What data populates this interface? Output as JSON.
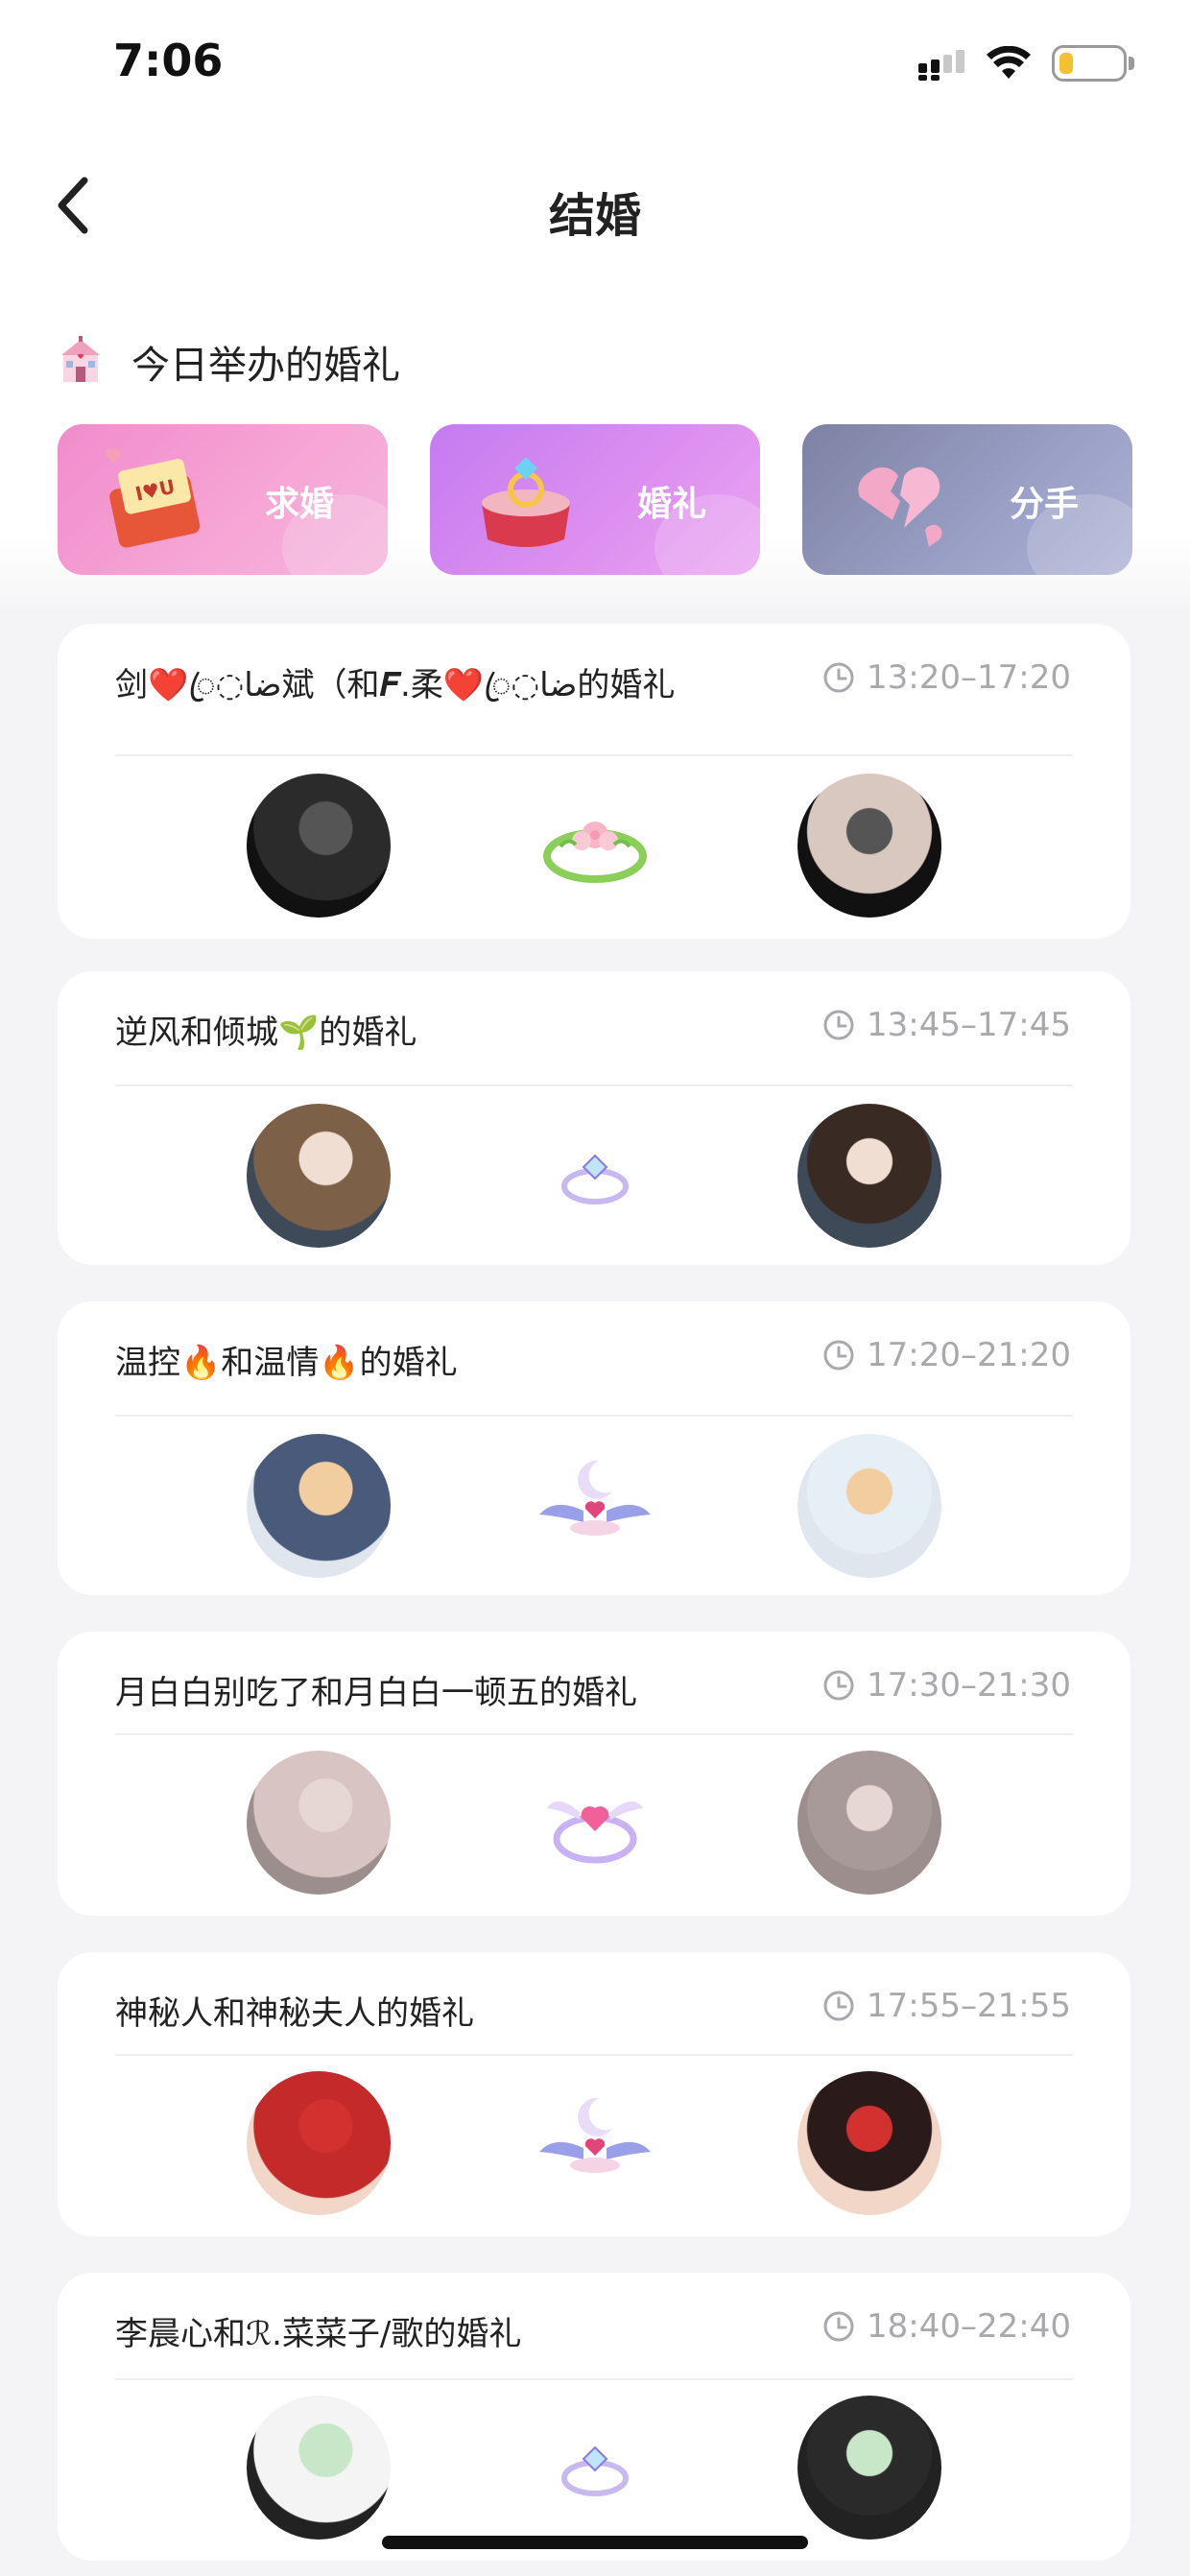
{
  "status_bar": {
    "time": "7:06"
  },
  "header": {
    "title": "结婚"
  },
  "section": {
    "title": "今日举办的婚礼"
  },
  "categories": [
    {
      "label": "求婚",
      "color": "#f08ccc"
    },
    {
      "label": "婚礼",
      "color": "#c47bf0"
    },
    {
      "label": "分手",
      "color": "#7d82a3"
    }
  ],
  "weddings": [
    {
      "title": "剑❤️ꦿ◌ضا斌（和𝑭.柔❤️ꦿ◌ضا的婚礼",
      "time": "13:20–17:20",
      "ring": "flower-ring-icon"
    },
    {
      "title": "逆风和倾城🌱的婚礼",
      "time": "13:45–17:45",
      "ring": "diamond-ring-icon"
    },
    {
      "title": "温控🔥和温情🔥的婚礼",
      "time": "17:20–21:20",
      "ring": "winged-moon-ring-icon"
    },
    {
      "title": "月白白别吃了和月白白一顿五的婚礼",
      "time": "17:30–21:30",
      "ring": "winged-heart-ring-icon"
    },
    {
      "title": "神秘人和神秘夫人的婚礼",
      "time": "17:55–21:55",
      "ring": "winged-moon-ring-icon"
    },
    {
      "title": "李晨心和ℛ.菜菜子/歌的婚礼",
      "time": "18:40–22:40",
      "ring": "diamond-ring-icon"
    }
  ]
}
